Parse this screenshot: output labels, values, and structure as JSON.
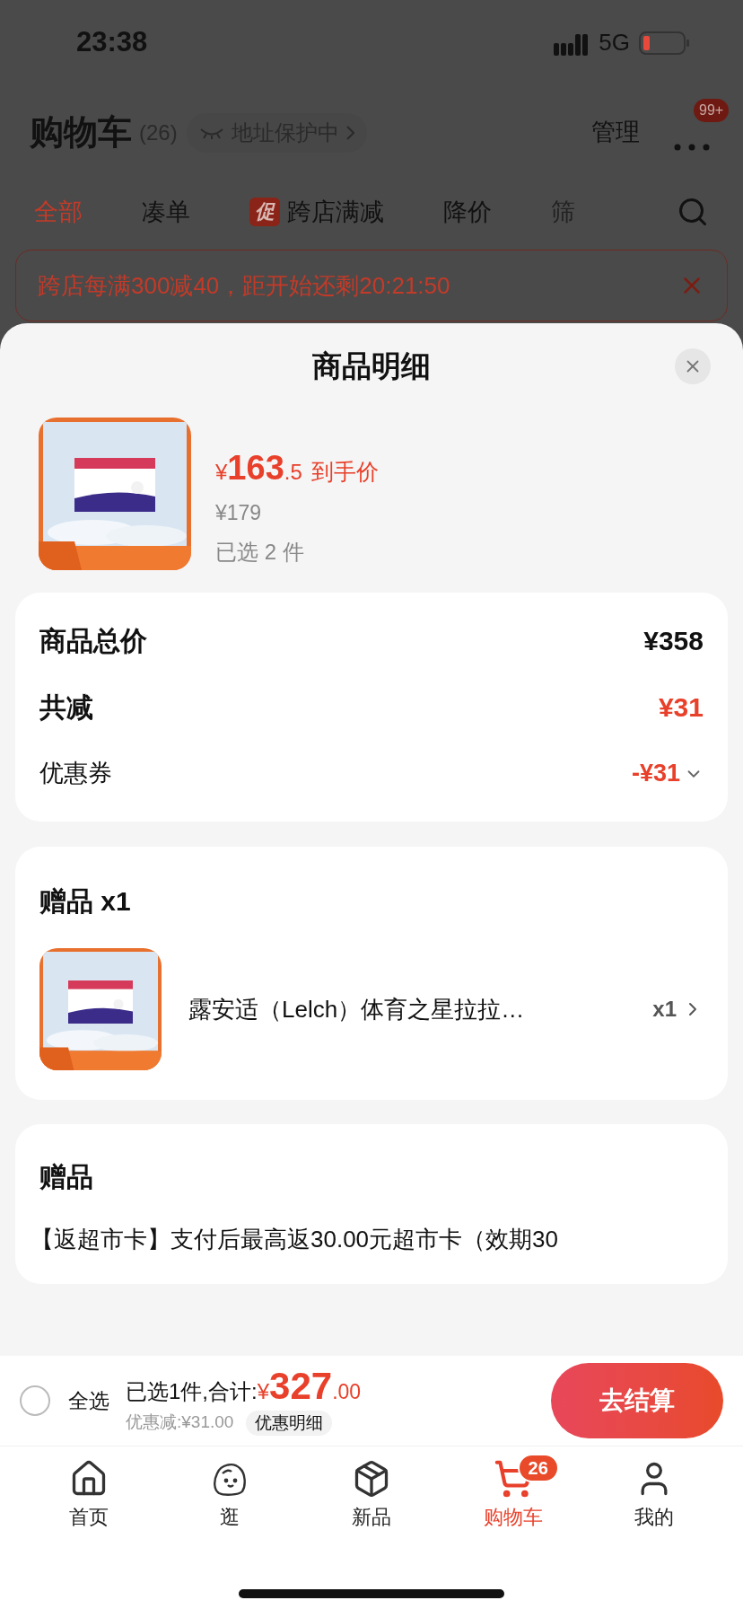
{
  "status_bar": {
    "time": "23:38",
    "network": "5G"
  },
  "header": {
    "title": "购物车",
    "count": "(26)",
    "address_badge": "地址保护中",
    "manage": "管理",
    "more_badge": "99+"
  },
  "filter_tabs": [
    {
      "label": "全部",
      "selected": true
    },
    {
      "label": "凑单",
      "selected": false
    },
    {
      "label": "跨店满减",
      "selected": false,
      "tag": "促"
    },
    {
      "label": "降价",
      "selected": false
    },
    {
      "label": "筛",
      "selected": false
    }
  ],
  "banner": {
    "text": "跨店每满300减40，距开始还剩20:21:50"
  },
  "sheet": {
    "title": "商品明细",
    "product": {
      "currency": "¥",
      "price_int": "163",
      "price_dec": ".5",
      "price_label": "到手价",
      "original_price": "¥179",
      "selected_count": "已选 2 件"
    },
    "summary": [
      {
        "kind": "total",
        "label": "商品总价",
        "value": "¥358"
      },
      {
        "kind": "discount",
        "label": "共减",
        "value": "¥31"
      },
      {
        "kind": "coupon",
        "label": "优惠券",
        "value": "-¥31"
      }
    ],
    "gift": {
      "title": "赠品 x1",
      "name": "露安适（Lelch）体育之星拉拉…",
      "quantity": "x1"
    },
    "gift_note": {
      "title": "赠品",
      "text": "【返超市卡】支付后最高返30.00元超市卡（效期30"
    }
  },
  "checkout": {
    "select_all": {
      "label": "全选",
      "checked": false
    },
    "summary": "已选1件,合计:",
    "currency": "¥",
    "amount": "327",
    "decimals": ".00",
    "discount": "优惠减:¥31.00",
    "detail_link": "优惠明细",
    "button": "去结算"
  },
  "nav": [
    {
      "kind": "home",
      "label": "首页",
      "selected": false
    },
    {
      "kind": "browse",
      "label": "逛",
      "selected": false
    },
    {
      "kind": "new",
      "label": "新品",
      "selected": false
    },
    {
      "kind": "cart",
      "label": "购物车",
      "selected": true,
      "badge": "26"
    },
    {
      "kind": "profile",
      "label": "我的",
      "selected": false
    }
  ]
}
